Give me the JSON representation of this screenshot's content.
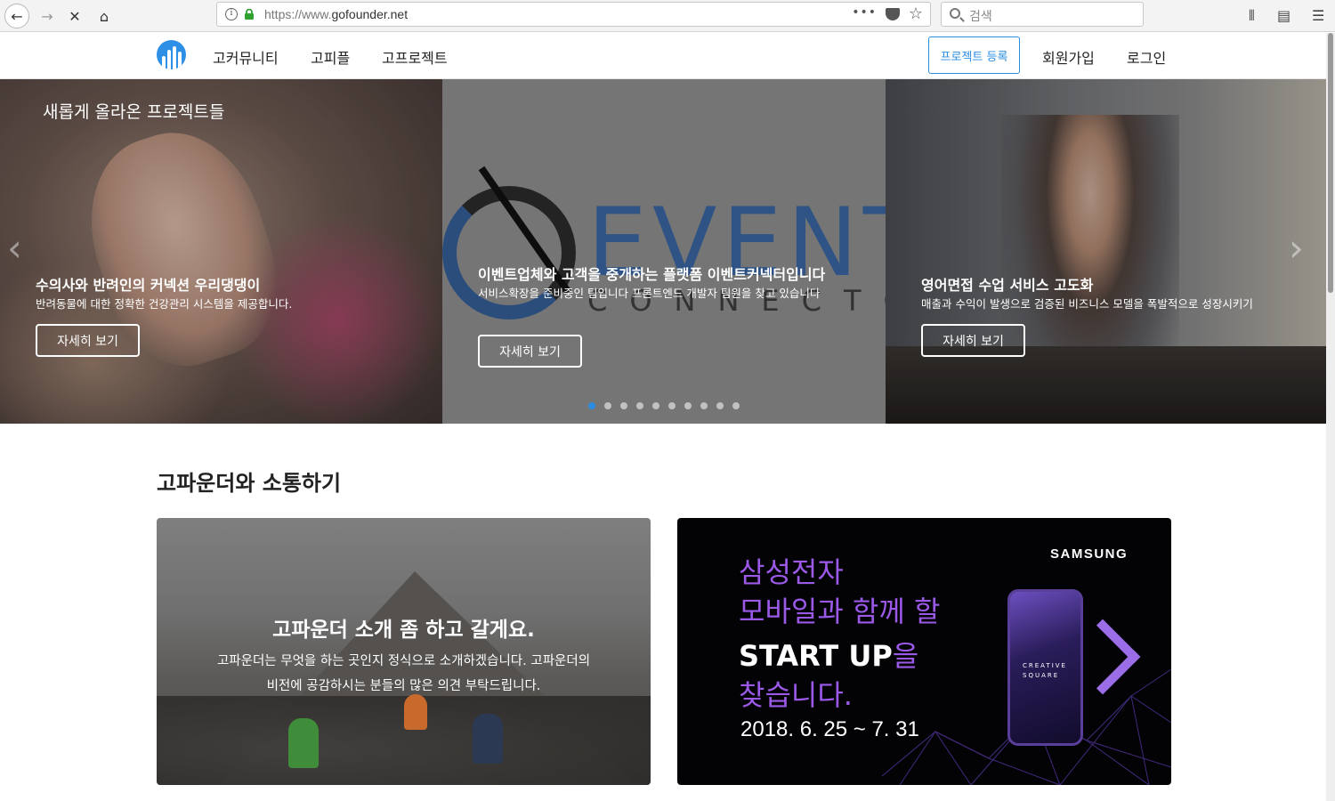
{
  "browser": {
    "url_protocol": "https://www.",
    "url_domain": "gofounder.net",
    "search_placeholder": "검색"
  },
  "header": {
    "menu": [
      "고커뮤니티",
      "고피플",
      "고프로젝트"
    ],
    "register_button": "프로젝트 등록",
    "signup": "회원가입",
    "login": "로그인"
  },
  "hero": {
    "heading": "새롭게 올라온 프로젝트들",
    "slides": [
      {
        "title": "수의사와 반려인의 커넥션 우리댕댕이",
        "desc": "반려동물에 대한 정확한 건강관리 시스템을 제공합니다.",
        "button": "자세히 보기"
      },
      {
        "title": "이벤트업체와 고객을 중개하는 플랫폼 이벤트커넥터입니다",
        "desc": "서비스확장을 준비중인 팀입니다 프론트엔드 개발자 팀원을 찾고 있습니다",
        "button": "자세히 보기",
        "image_text_big": "EVENT",
        "image_text_small": "CONNECTO"
      },
      {
        "title": "영어면접 수업 서비스 고도화",
        "desc": "매출과 수익이 발생으로 검증된 비즈니스 모델을 폭발적으로 성장시키기",
        "button": "자세히 보기"
      }
    ],
    "dot_count": 10,
    "active_dot": 0,
    "accent_color": "#2b8de0"
  },
  "section": {
    "title": "고파운더와 소통하기"
  },
  "cards": {
    "left": {
      "title": "고파운더 소개 좀 하고 갈게요.",
      "desc_line1": "고파운더는 무엇을 하는 곳인지 정식으로 소개하겠습니다. 고파운더의",
      "desc_line2": "비전에 공감하시는 분들의 많은 의견 부탁드립니다."
    },
    "right": {
      "brand": "SAMSUNG",
      "line1": "삼성전자",
      "line2": "모바일과 함께 할",
      "line3_bold": "START UP",
      "line3_rest": "을",
      "line4": "찾습니다.",
      "date": "2018. 6. 25 ~ 7. 31",
      "phone_text1": "CREATIVE",
      "phone_text2": "SQUARE",
      "accent_color": "#9b59e8"
    }
  }
}
